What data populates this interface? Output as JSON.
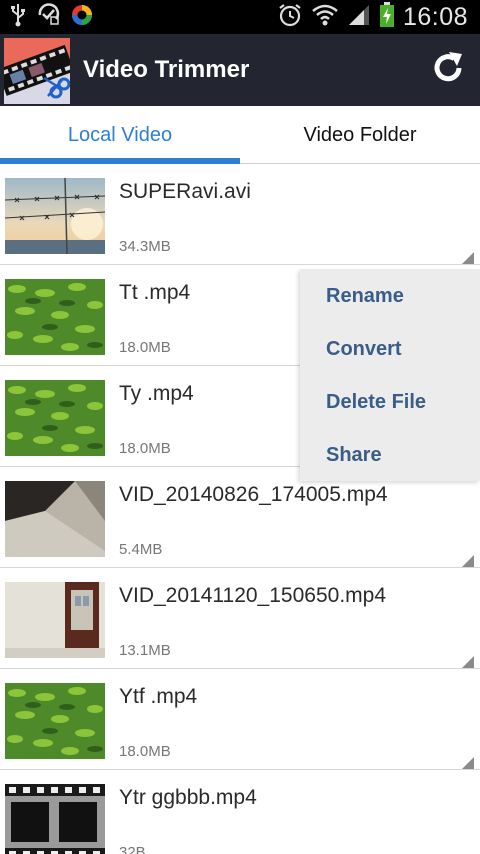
{
  "status_bar": {
    "time": "16:08",
    "left_icons": [
      "usb-icon",
      "alarm-shield-icon",
      "colorful-app-icon"
    ],
    "right_icons": [
      "alarm-clock-icon",
      "wifi-icon",
      "signal-icon",
      "battery-charging-icon"
    ]
  },
  "app": {
    "title": "Video Trimmer",
    "bar_color": "#232631",
    "accent_color": "#2b7fd4"
  },
  "tabs": [
    {
      "label": "Local Video",
      "selected": true
    },
    {
      "label": "Video Folder",
      "selected": false
    }
  ],
  "files": [
    {
      "name": "SUPERavi.avi",
      "size": "34.3MB",
      "thumb": "barbed-wire"
    },
    {
      "name": "Tt .mp4",
      "size": "18.0MB",
      "thumb": "green-leaves"
    },
    {
      "name": "Ty .mp4",
      "size": "18.0MB",
      "thumb": "green-leaves"
    },
    {
      "name": "VID_20140826_174005.mp4",
      "size": "5.4MB",
      "thumb": "dark-room"
    },
    {
      "name": "VID_20141120_150650.mp4",
      "size": "13.1MB",
      "thumb": "doorway"
    },
    {
      "name": "Ytf .mp4",
      "size": "18.0MB",
      "thumb": "green-leaves"
    },
    {
      "name": "Ytr ggbbb.mp4",
      "size": "32B",
      "thumb": "film-strip"
    }
  ],
  "context_menu": {
    "items": [
      "Rename",
      "Convert",
      "Delete File",
      "Share"
    ]
  }
}
